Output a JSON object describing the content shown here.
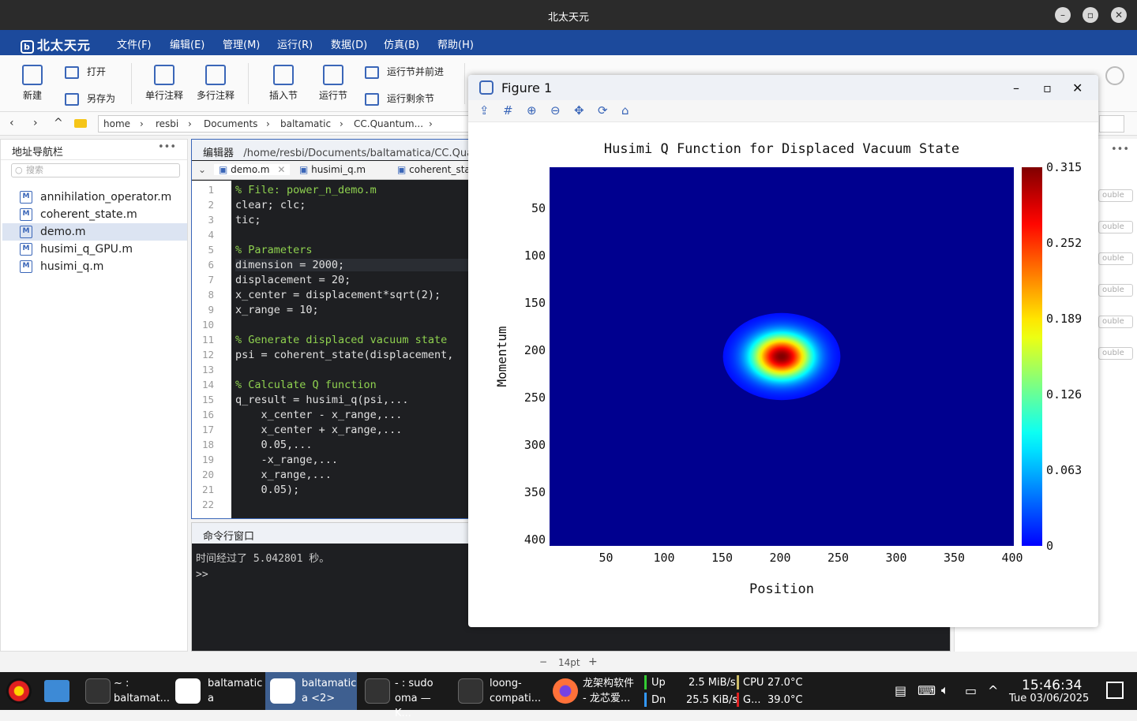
{
  "window": {
    "title": "北太天元"
  },
  "menubar": {
    "logo": "北太天元",
    "items": [
      "文件(F)",
      "编辑(E)",
      "管理(M)",
      "运行(R)",
      "数据(D)",
      "仿真(B)",
      "帮助(H)"
    ]
  },
  "toolbar": {
    "new": "新建",
    "open": "打开",
    "save_as": "另存为",
    "single_comment": "单行注释",
    "multi_comment": "多行注释",
    "insert_section": "插入节",
    "run_section": "运行节",
    "run_section_advance": "运行节并前进",
    "run_remaining": "运行剩余节"
  },
  "address": {
    "crumbs": [
      "home",
      "resbi",
      "Documents",
      "baltamatic",
      "CC.Quantum..."
    ]
  },
  "navigator": {
    "title": "地址导航栏",
    "search_placeholder": "搜索",
    "files": [
      "annihilation_operator.m",
      "coherent_state.m",
      "demo.m",
      "husimi_q_GPU.m",
      "husimi_q.m"
    ],
    "selected": "demo.m"
  },
  "editor": {
    "title": "编辑器",
    "path": "/home/resbi/Documents/baltamatica/CC.Quantum",
    "tabs": [
      "demo.m",
      "husimi_q.m",
      "coherent_sta"
    ],
    "line_numbers": [
      "1",
      "2",
      "3",
      "4",
      "5",
      "6",
      "7",
      "8",
      "9",
      "10",
      "11",
      "12",
      "13",
      "14",
      "15",
      "16",
      "17",
      "18",
      "19",
      "20",
      "21",
      "22"
    ],
    "lines": [
      "% File: power_n_demo.m",
      "clear; clc;",
      "tic;",
      "",
      "% Parameters",
      "dimension = 2000;",
      "displacement = 20;",
      "x_center = displacement*sqrt(2);",
      "x_range = 10;",
      "",
      "% Generate displaced vacuum state",
      "psi = coherent_state(displacement,",
      "",
      "% Calculate Q function",
      "q_result = husimi_q(psi,...",
      "    x_center - x_range,...",
      "    x_center + x_range,...",
      "    0.05,...",
      "    -x_range,...",
      "    x_range,...",
      "    0.05);",
      ""
    ]
  },
  "command": {
    "title": "命令行窗口",
    "output": "时间经过了 5.042801 秒。",
    "prompt": ">>"
  },
  "workspace": {
    "type_labels": [
      "ouble",
      "ouble",
      "ouble",
      "ouble",
      "ouble",
      "ouble"
    ]
  },
  "status": {
    "font_size": "14pt",
    "minus": "−",
    "plus": "+"
  },
  "figure": {
    "title": "Figure 1",
    "toolbar_icons": [
      "save-icon",
      "grid-icon",
      "zoom-in-icon",
      "zoom-out-icon",
      "pan-icon",
      "rotate-icon",
      "home-icon"
    ]
  },
  "chart_data": {
    "type": "heatmap",
    "title": "Husimi Q Function for Displaced Vacuum State",
    "xlabel": "Position",
    "ylabel": "Momentum",
    "xticks": [
      50,
      100,
      150,
      200,
      250,
      300,
      350,
      400
    ],
    "yticks": [
      50,
      100,
      150,
      200,
      250,
      300,
      350,
      400
    ],
    "xlim": [
      0,
      400
    ],
    "ylim": [
      0,
      400
    ],
    "y_direction": "top-to-bottom",
    "colormap": "jet",
    "colorbar_ticks": [
      "0.315",
      "0.252",
      "0.189",
      "0.126",
      "0.063",
      "0"
    ],
    "clim": [
      0,
      0.315
    ],
    "peak": {
      "x": 200,
      "y": 200,
      "value": 0.315
    },
    "spread": {
      "x": 22,
      "y": 20
    },
    "background_color": "#00008f"
  },
  "taskbar": {
    "items": [
      {
        "line1": "~ :",
        "line2": "baltamat..."
      },
      {
        "line1": "baltamatic",
        "line2": "a"
      },
      {
        "line1": "baltamatic",
        "line2": "a <2>"
      },
      {
        "line1": "- : sudo",
        "line2": "oma — K..."
      },
      {
        "line1": "loong-",
        "line2": "compati..."
      },
      {
        "line1": "龙架构软件",
        "line2": "- 龙芯爱..."
      }
    ],
    "net": {
      "up_label": "Up",
      "down_label": "Dn",
      "up": "2.5 MiB/s",
      "down": "25.5 KiB/s"
    },
    "cpu": {
      "label": "CPU",
      "temp1": "27.0°C",
      "label2": "G...",
      "temp2": "39.0°C"
    },
    "clock": {
      "time": "15:46:34",
      "date": "Tue 03/06/2025"
    }
  }
}
